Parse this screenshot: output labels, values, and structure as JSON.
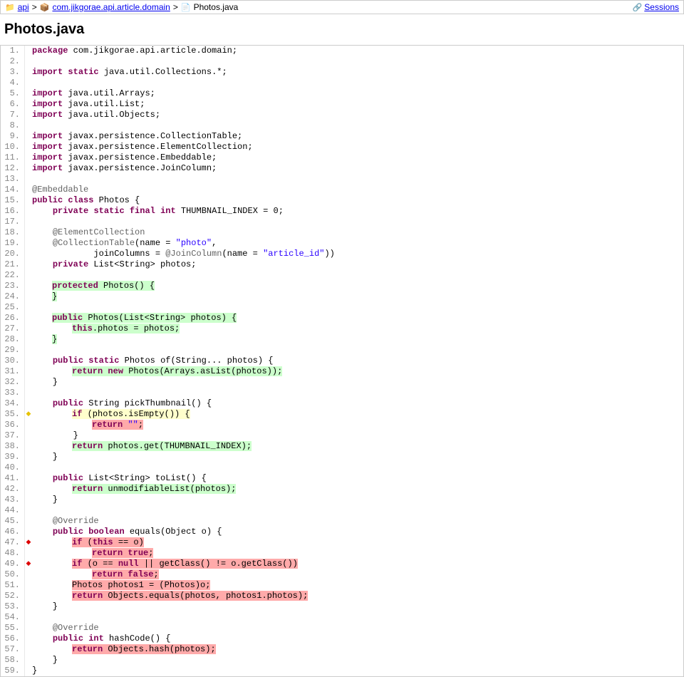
{
  "breadcrumb": {
    "api_label": "api",
    "package_label": "com.jikgorae.api.article.domain",
    "file_label": "Photos.java",
    "sep": ">"
  },
  "sessions_label": "Sessions",
  "title": "Photos.java",
  "lines": [
    {
      "n": 1,
      "bg": "",
      "mk": "",
      "html": "<span class='kw'>package</span> com.jikgorae.api.article.domain;"
    },
    {
      "n": 2,
      "bg": "",
      "mk": "",
      "html": ""
    },
    {
      "n": 3,
      "bg": "",
      "mk": "",
      "html": "<span class='kw'>import</span> <span class='kw'>static</span> java.util.Collections.*;"
    },
    {
      "n": 4,
      "bg": "",
      "mk": "",
      "html": ""
    },
    {
      "n": 5,
      "bg": "",
      "mk": "",
      "html": "<span class='kw'>import</span> java.util.Arrays;"
    },
    {
      "n": 6,
      "bg": "",
      "mk": "",
      "html": "<span class='kw'>import</span> java.util.List;"
    },
    {
      "n": 7,
      "bg": "",
      "mk": "",
      "html": "<span class='kw'>import</span> java.util.Objects;"
    },
    {
      "n": 8,
      "bg": "",
      "mk": "",
      "html": ""
    },
    {
      "n": 9,
      "bg": "",
      "mk": "",
      "html": "<span class='kw'>import</span> javax.persistence.CollectionTable;"
    },
    {
      "n": 10,
      "bg": "",
      "mk": "",
      "html": "<span class='kw'>import</span> javax.persistence.ElementCollection;"
    },
    {
      "n": 11,
      "bg": "",
      "mk": "",
      "html": "<span class='kw'>import</span> javax.persistence.Embeddable;"
    },
    {
      "n": 12,
      "bg": "",
      "mk": "",
      "html": "<span class='kw'>import</span> javax.persistence.JoinColumn;"
    },
    {
      "n": 13,
      "bg": "",
      "mk": "",
      "html": ""
    },
    {
      "n": 14,
      "bg": "",
      "mk": "",
      "html": "<span class='ann'>@Embeddable</span>"
    },
    {
      "n": 15,
      "bg": "",
      "mk": "",
      "html": "<span class='kw'>public</span> <span class='kw'>class</span> Photos {"
    },
    {
      "n": 16,
      "bg": "",
      "mk": "",
      "html": "    <span class='kw'>private</span> <span class='kw'>static</span> <span class='kw'>final</span> <span class='kw'>int</span> THUMBNAIL_INDEX = 0;"
    },
    {
      "n": 17,
      "bg": "",
      "mk": "",
      "html": ""
    },
    {
      "n": 18,
      "bg": "",
      "mk": "",
      "html": "    <span class='ann'>@ElementCollection</span>"
    },
    {
      "n": 19,
      "bg": "",
      "mk": "",
      "html": "    <span class='ann'>@CollectionTable</span>(name = <span class='str'>\"photo\"</span>,"
    },
    {
      "n": 20,
      "bg": "",
      "mk": "",
      "html": "            joinColumns = <span class='ann'>@JoinColumn</span>(name = <span class='str'>\"article_id\"</span>))"
    },
    {
      "n": 21,
      "bg": "",
      "mk": "",
      "html": "    <span class='kw'>private</span> List&lt;String&gt; photos;"
    },
    {
      "n": 22,
      "bg": "",
      "mk": "",
      "html": ""
    },
    {
      "n": 23,
      "bg": "green",
      "mk": "",
      "indent": 1,
      "html": "<span class='kw'>protected</span> Photos() {"
    },
    {
      "n": 24,
      "bg": "green",
      "mk": "",
      "indent": 1,
      "html": "}"
    },
    {
      "n": 25,
      "bg": "",
      "mk": "",
      "html": ""
    },
    {
      "n": 26,
      "bg": "green",
      "mk": "",
      "indent": 1,
      "html": "<span class='kw'>public</span> Photos(List&lt;String&gt; photos) {"
    },
    {
      "n": 27,
      "bg": "green",
      "mk": "",
      "indent": 2,
      "html": "<span class='kw'>this</span>.photos = photos;"
    },
    {
      "n": 28,
      "bg": "green",
      "mk": "",
      "indent": 1,
      "html": "}"
    },
    {
      "n": 29,
      "bg": "",
      "mk": "",
      "html": ""
    },
    {
      "n": 30,
      "bg": "",
      "mk": "",
      "html": "    <span class='kw'>public</span> <span class='kw'>static</span> Photos of(String... photos) {"
    },
    {
      "n": 31,
      "bg": "green",
      "mk": "",
      "indent": 2,
      "html": "<span class='kw'>return</span> <span class='kw'>new</span> Photos(Arrays.asList(photos));"
    },
    {
      "n": 32,
      "bg": "",
      "mk": "",
      "html": "    }"
    },
    {
      "n": 33,
      "bg": "",
      "mk": "",
      "html": ""
    },
    {
      "n": 34,
      "bg": "",
      "mk": "",
      "html": "    <span class='kw'>public</span> String pickThumbnail() {"
    },
    {
      "n": 35,
      "bg": "yellow",
      "mk": "yellow",
      "indent": 2,
      "html": "<span class='kw'>if</span> (photos.isEmpty()) {"
    },
    {
      "n": 36,
      "bg": "red",
      "mk": "",
      "indent": 3,
      "html": "<span class='kw'>return</span> <span class='str'>\"\"</span>;"
    },
    {
      "n": 37,
      "bg": "",
      "mk": "",
      "html": "        }"
    },
    {
      "n": 38,
      "bg": "green",
      "mk": "",
      "indent": 2,
      "html": "<span class='kw'>return</span> photos.get(THUMBNAIL_INDEX);"
    },
    {
      "n": 39,
      "bg": "",
      "mk": "",
      "html": "    }"
    },
    {
      "n": 40,
      "bg": "",
      "mk": "",
      "html": ""
    },
    {
      "n": 41,
      "bg": "",
      "mk": "",
      "html": "    <span class='kw'>public</span> List&lt;String&gt; toList() {"
    },
    {
      "n": 42,
      "bg": "green",
      "mk": "",
      "indent": 2,
      "html": "<span class='kw'>return</span> unmodifiableList(photos);"
    },
    {
      "n": 43,
      "bg": "",
      "mk": "",
      "html": "    }"
    },
    {
      "n": 44,
      "bg": "",
      "mk": "",
      "html": ""
    },
    {
      "n": 45,
      "bg": "",
      "mk": "",
      "html": "    <span class='ann'>@Override</span>"
    },
    {
      "n": 46,
      "bg": "",
      "mk": "",
      "html": "    <span class='kw'>public</span> <span class='kw'>boolean</span> equals(Object o) {"
    },
    {
      "n": 47,
      "bg": "red",
      "mk": "red",
      "indent": 2,
      "html": "<span class='kw'>if</span> (<span class='kw'>this</span> == o)"
    },
    {
      "n": 48,
      "bg": "red",
      "mk": "",
      "indent": 3,
      "html": "<span class='kw'>return</span> <span class='kw'>true</span>;"
    },
    {
      "n": 49,
      "bg": "red",
      "mk": "red",
      "indent": 2,
      "html": "<span class='kw'>if</span> (o == <span class='kw'>null</span> || getClass() != o.getClass())"
    },
    {
      "n": 50,
      "bg": "red",
      "mk": "",
      "indent": 3,
      "html": "<span class='kw'>return</span> <span class='kw'>false</span>;"
    },
    {
      "n": 51,
      "bg": "red",
      "mk": "",
      "indent": 2,
      "html": "Photos photos1 = (Photos)o;"
    },
    {
      "n": 52,
      "bg": "red",
      "mk": "",
      "indent": 2,
      "html": "<span class='kw'>return</span> Objects.equals(photos, photos1.photos);"
    },
    {
      "n": 53,
      "bg": "",
      "mk": "",
      "html": "    }"
    },
    {
      "n": 54,
      "bg": "",
      "mk": "",
      "html": ""
    },
    {
      "n": 55,
      "bg": "",
      "mk": "",
      "html": "    <span class='ann'>@Override</span>"
    },
    {
      "n": 56,
      "bg": "",
      "mk": "",
      "html": "    <span class='kw'>public</span> <span class='kw'>int</span> hashCode() {"
    },
    {
      "n": 57,
      "bg": "red",
      "mk": "",
      "indent": 2,
      "html": "<span class='kw'>return</span> Objects.hash(photos);"
    },
    {
      "n": 58,
      "bg": "",
      "mk": "",
      "html": "    }"
    },
    {
      "n": 59,
      "bg": "",
      "mk": "",
      "html": "}"
    }
  ]
}
